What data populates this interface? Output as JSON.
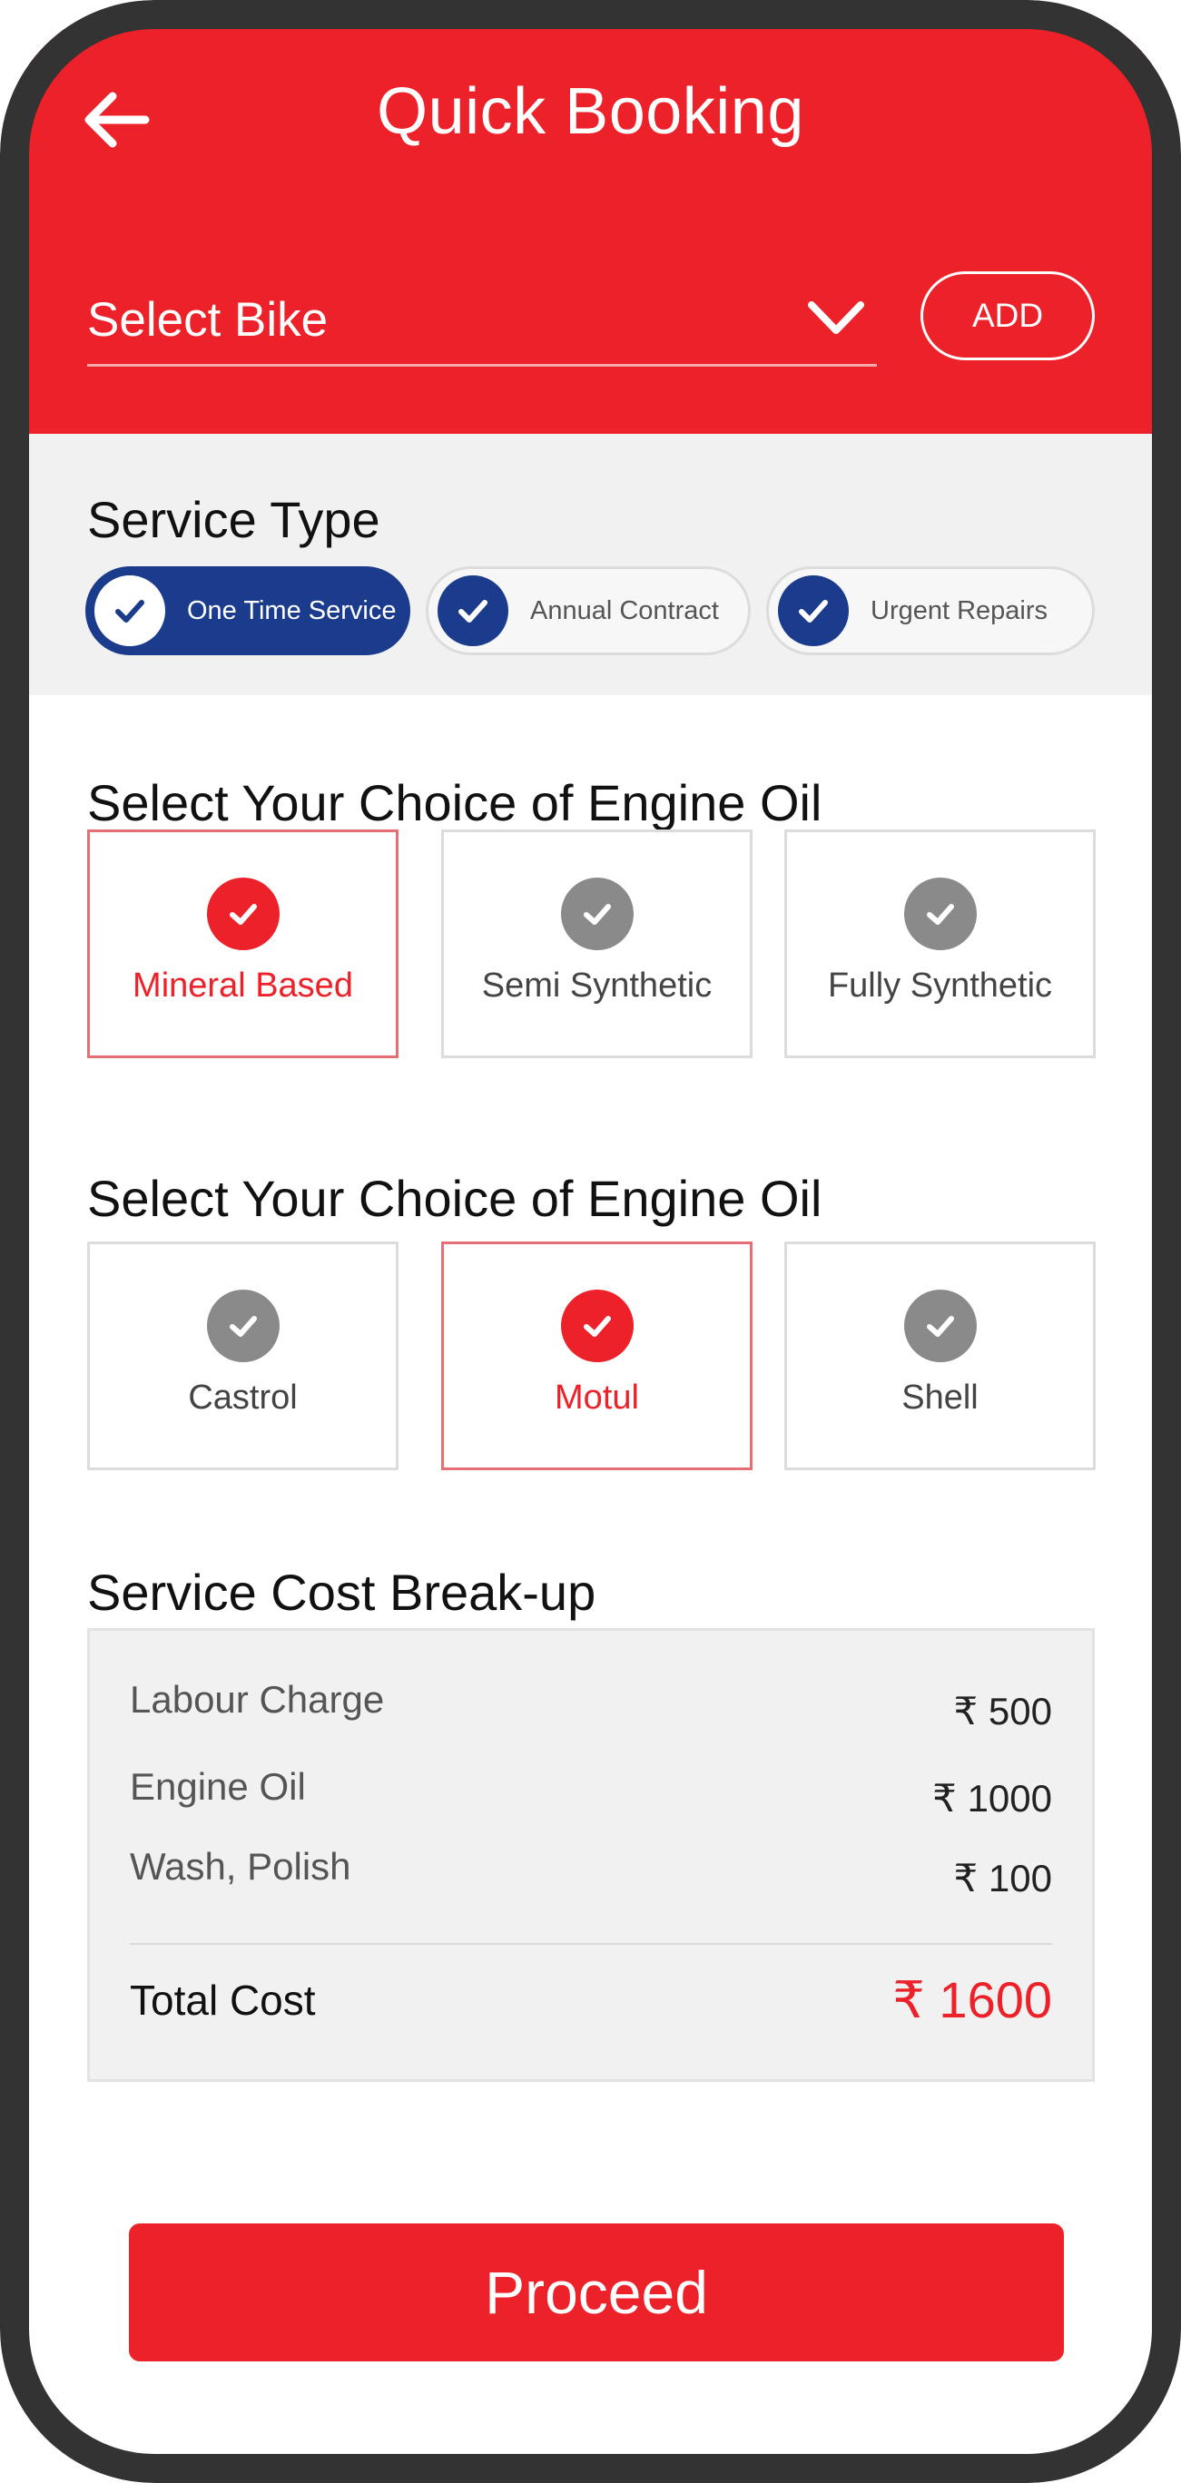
{
  "header": {
    "title": "Quick Booking",
    "select_bike_placeholder": "Select Bike",
    "add_label": "ADD",
    "back_icon": "arrow-left-icon",
    "dropdown_icon": "chevron-down-icon"
  },
  "service_type": {
    "title": "Service Type",
    "options": [
      {
        "label": "One Time Service",
        "selected": true
      },
      {
        "label": "Annual Contract",
        "selected": false
      },
      {
        "label": "Urgent Repairs",
        "selected": false
      }
    ]
  },
  "engine_oil_type": {
    "title": "Select Your Choice of Engine Oil",
    "options": [
      {
        "label": "Mineral Based",
        "selected": true
      },
      {
        "label": "Semi Synthetic",
        "selected": false
      },
      {
        "label": "Fully Synthetic",
        "selected": false
      }
    ]
  },
  "engine_oil_brand": {
    "title": "Select Your Choice of Engine Oil",
    "options": [
      {
        "label": "Castrol",
        "selected": false
      },
      {
        "label": "Motul",
        "selected": true
      },
      {
        "label": "Shell",
        "selected": false
      }
    ]
  },
  "cost": {
    "title": "Service Cost Break-up",
    "items": [
      {
        "label": "Labour Charge",
        "value": "₹ 500"
      },
      {
        "label": "Engine Oil",
        "value": "₹ 1000"
      },
      {
        "label": "Wash, Polish",
        "value": "₹ 100"
      }
    ],
    "total_label": "Total Cost",
    "total_value": "₹ 1600"
  },
  "proceed_label": "Proceed",
  "colors": {
    "brand_red": "#ec2129",
    "brand_blue": "#1b3c8c",
    "frame": "#333333",
    "inactive_check": "#8a8a8a"
  }
}
